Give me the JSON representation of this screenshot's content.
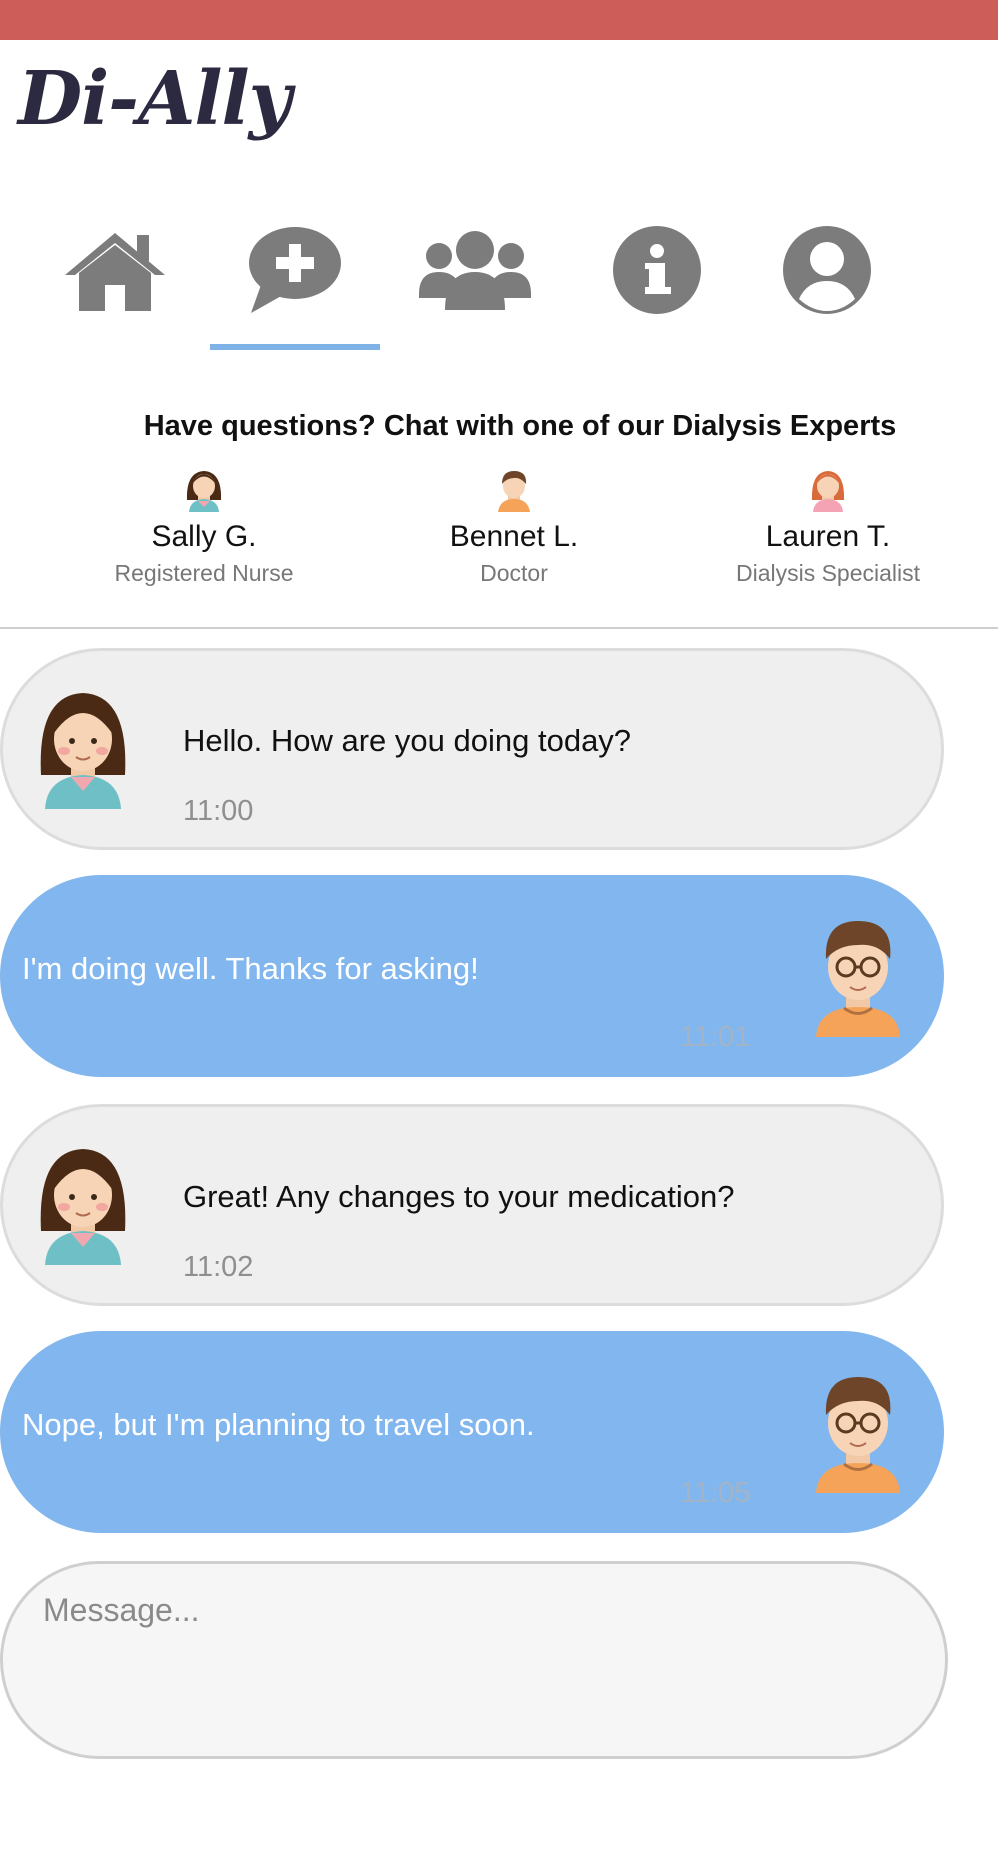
{
  "app": {
    "logo_text": "Di-Ally",
    "brand_color": "#cd5d59",
    "accent_color": "#82b6ee"
  },
  "nav": {
    "active": "chat",
    "items": [
      {
        "id": "home",
        "icon": "home-icon"
      },
      {
        "id": "chat",
        "icon": "chat-plus-icon"
      },
      {
        "id": "community",
        "icon": "users-icon"
      },
      {
        "id": "info",
        "icon": "info-icon"
      },
      {
        "id": "profile",
        "icon": "user-circle-icon"
      }
    ]
  },
  "experts": {
    "headline": "Have questions? Chat with one of our Dialysis Experts",
    "list": [
      {
        "name": "Sally G.",
        "role": "Registered Nurse",
        "avatar": "nurse-avatar-icon"
      },
      {
        "name": "Bennet L.",
        "role": "Doctor",
        "avatar": "doctor-avatar-icon"
      },
      {
        "name": "Lauren T.",
        "role": "Dialysis Specialist",
        "avatar": "specialist-avatar-icon"
      }
    ]
  },
  "messages": [
    {
      "direction": "incoming",
      "text": "Hello. How are you doing today?",
      "time": "11:00",
      "avatar": "nurse-avatar-icon"
    },
    {
      "direction": "outgoing",
      "text": "I'm doing well. Thanks for asking!",
      "time": "11:01",
      "avatar": "user-avatar-icon"
    },
    {
      "direction": "incoming",
      "text": "Great! Any changes to your medication?",
      "time": "11:02",
      "avatar": "nurse-avatar-icon"
    },
    {
      "direction": "outgoing",
      "text": "Nope, but I'm planning to travel soon.",
      "time": "11:05",
      "avatar": "user-avatar-icon"
    }
  ],
  "composer": {
    "placeholder": "Message...",
    "value": ""
  }
}
